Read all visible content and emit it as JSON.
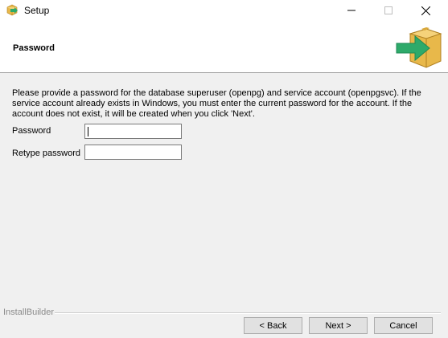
{
  "window": {
    "title": "Setup",
    "icon": "box-icon"
  },
  "controls": {
    "minimize": "minimize-icon",
    "maximize": "maximize-icon",
    "close": "close-icon"
  },
  "header": {
    "title": "Password",
    "icon": "box-arrow-icon"
  },
  "body": {
    "description": "Please provide a password for the database superuser (openpg) and service account (openpgsvc). If the service account already exists in Windows, you must enter the current password for the account. If the account does not exist, it will be created when you click 'Next'.",
    "password_label": "Password",
    "password_value": "",
    "retype_label": "Retype password",
    "retype_value": ""
  },
  "footer": {
    "brand": "InstallBuilder",
    "back_label": "< Back",
    "next_label": "Next >",
    "cancel_label": "Cancel"
  },
  "colors": {
    "box": "#e8b84a",
    "arrow": "#2eaa6a",
    "header_bg": "#ffffff",
    "body_bg": "#f0f0f0"
  }
}
